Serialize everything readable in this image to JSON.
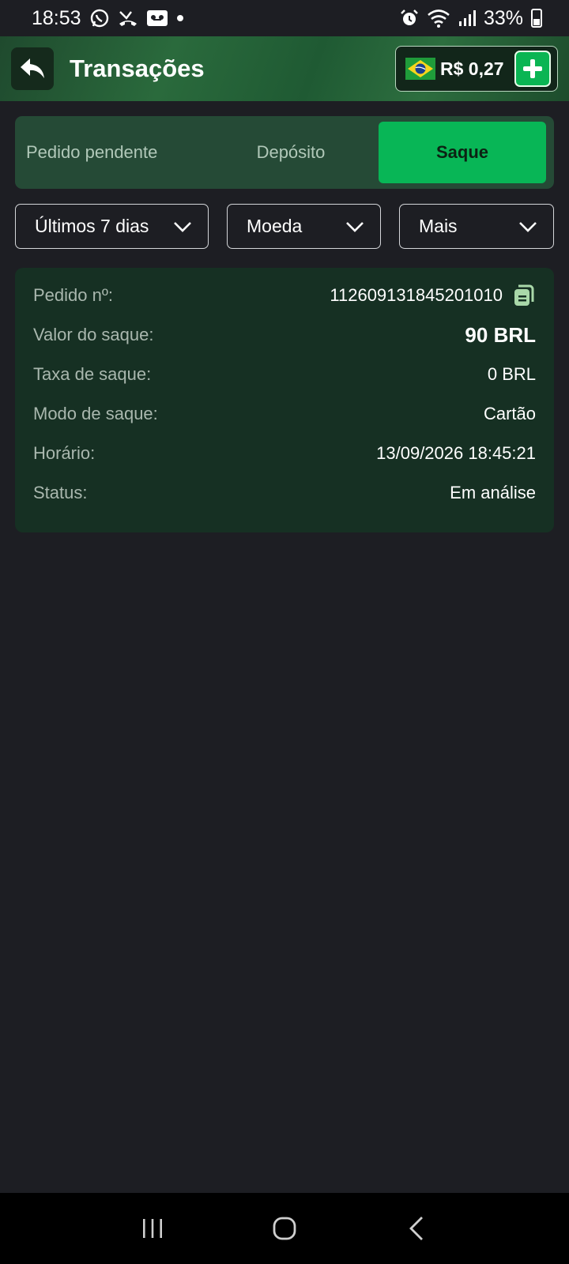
{
  "status_bar": {
    "time": "18:53",
    "battery": "33%"
  },
  "header": {
    "title": "Transações",
    "balance": "R$ 0,27"
  },
  "tabs": [
    {
      "label": "Pedido pendente",
      "active": false
    },
    {
      "label": "Depósito",
      "active": false
    },
    {
      "label": "Saque",
      "active": true
    }
  ],
  "filters": {
    "period": "Últimos 7 dias",
    "currency": "Moeda",
    "more": "Mais"
  },
  "transaction": {
    "order_label": "Pedido nº:",
    "order_value": "112609131845201010",
    "amount_label": "Valor do saque:",
    "amount_value": "90 BRL",
    "fee_label": "Taxa de saque:",
    "fee_value": "0 BRL",
    "mode_label": "Modo de saque:",
    "mode_value": "Cartão",
    "time_label": "Horário:",
    "time_value": "13/09/2026 18:45:21",
    "status_label": "Status:",
    "status_value": "Em análise"
  },
  "colors": {
    "accent": "#08b656",
    "card": "#163023",
    "background": "#1d1e23"
  }
}
